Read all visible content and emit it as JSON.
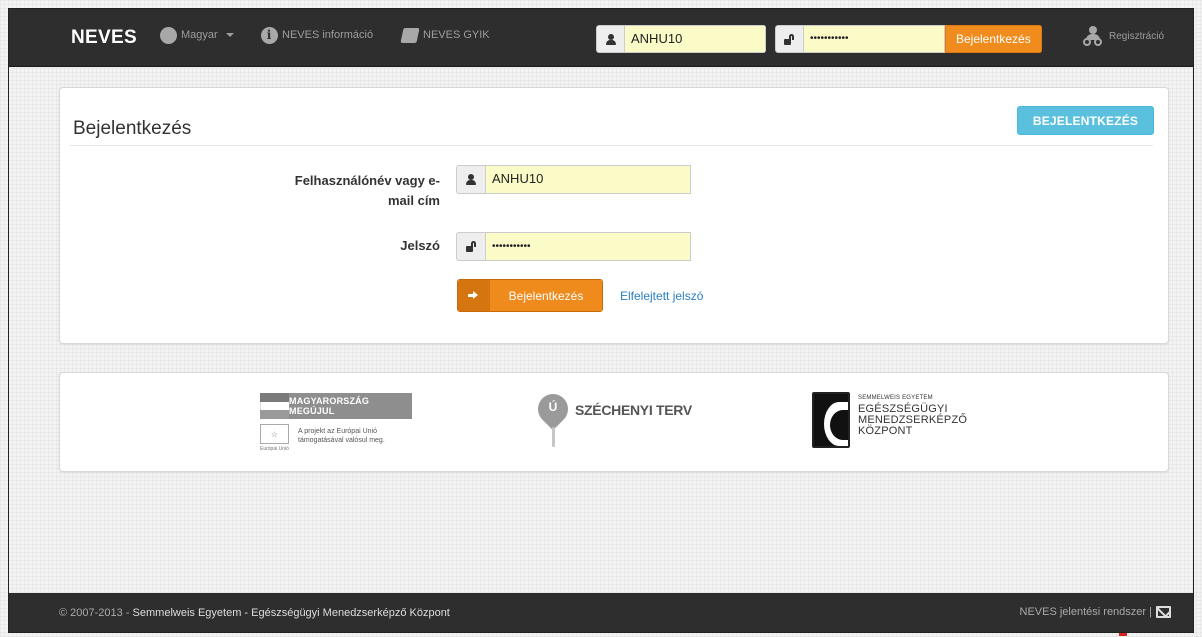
{
  "navbar": {
    "brand": "NEVES",
    "language": "Magyar",
    "info": "NEVES információ",
    "faq": "NEVES GYIK",
    "username_value": "ANHU10",
    "password_value": "•••••••••••",
    "login_button": "Bejelentkezés",
    "register": "Regisztráció",
    "icons": [
      "globe-icon",
      "info-icon",
      "book-icon",
      "user-icon",
      "lock-icon",
      "users-icon"
    ]
  },
  "login_panel": {
    "title": "Bejelentkezés",
    "top_button": "BEJELENTKEZÉS",
    "username_label_line1": "Felhasználónév vagy e-",
    "username_label_line2": "mail cím",
    "username_value": "ANHU10",
    "password_label": "Jelszó",
    "password_value": "•••••••••••",
    "submit_button": "Bejelentkezés",
    "forgot_link": "Elfelejtett jelszó"
  },
  "logos": {
    "mm_title": "MAGYARORSZÁG MEGÚJUL",
    "mm_text_line1": "A projekt az Európai Unió",
    "mm_text_line2": "támogatásával valósul meg.",
    "mm_eu_label": "Európai Unió",
    "sz_letter": "Ú",
    "sz_text": "SZÉCHENYI TERV",
    "se_small": "SEMMELWEIS EGYETEM",
    "se_line1": "EGÉSZSÉGÜGYI",
    "se_line2": "MENEDZSERKÉPZŐ",
    "se_line3": "KÖZPONT"
  },
  "footer": {
    "copyright": "© 2007-2013 - ",
    "org": "Semmelweis Egyetem - Egészségügyi Menedzserképző Központ",
    "system": "NEVES jelentési rendszer |"
  },
  "colors": {
    "navbar_bg": "#2e2e2e",
    "accent_orange": "#ef8a1d",
    "info_blue": "#5bc0de",
    "autofill_yellow": "#fbfbc8",
    "link_blue": "#2a7fc5"
  }
}
